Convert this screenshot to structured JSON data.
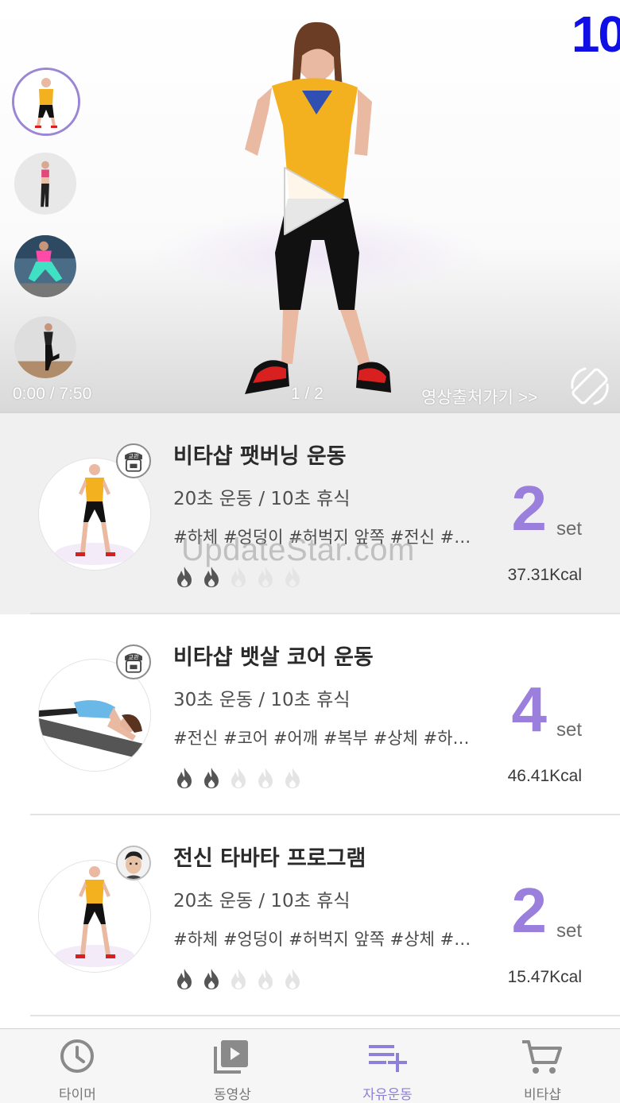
{
  "video": {
    "timer_display": "10",
    "elapsed": "0:00 / 7:50",
    "page": "1 / 2",
    "source_link": "영상출처가기 >>",
    "thumbnails": [
      "thumb-1",
      "thumb-2",
      "thumb-3",
      "thumb-4"
    ],
    "selected_thumbnail": 0
  },
  "watermark": "UpdateStar.com",
  "workouts": [
    {
      "title": "비타샵 팻버닝 운동",
      "time": "20초 운동 / 10초 휴식",
      "tags": "#하체 #엉덩이 #허벅지 앞쪽 #전신 #…",
      "intensity": 2,
      "intensity_max": 5,
      "sets": "2",
      "set_unit": "set",
      "kcal": "37.31Kcal",
      "badge": "교관",
      "active": true
    },
    {
      "title": "비타샵 뱃살 코어 운동",
      "time": "30초 운동 / 10초 휴식",
      "tags": "#전신 #코어 #어깨 #복부 #상체 #하…",
      "intensity": 2,
      "intensity_max": 5,
      "sets": "4",
      "set_unit": "set",
      "kcal": "46.41Kcal",
      "badge": "교관",
      "active": false
    },
    {
      "title": "전신 타바타 프로그램",
      "time": "20초 운동 / 10초 휴식",
      "tags": "#하체 #엉덩이 #허벅지 앞쪽 #상체 #…",
      "intensity": 2,
      "intensity_max": 5,
      "sets": "2",
      "set_unit": "set",
      "kcal": "15.47Kcal",
      "badge": "",
      "active": false
    }
  ],
  "tabs": [
    {
      "label": "타이머",
      "icon": "clock-icon",
      "active": false
    },
    {
      "label": "동영상",
      "icon": "video-library-icon",
      "active": false
    },
    {
      "label": "자유운동",
      "icon": "playlist-add-icon",
      "active": true
    },
    {
      "label": "비타샵",
      "icon": "cart-icon",
      "active": false
    }
  ],
  "colors": {
    "accent": "#9a7fdc",
    "tab_active": "#8e7fd8",
    "timer": "#1010e6",
    "flame_on": "#555555",
    "flame_off": "#e4e4e4"
  }
}
